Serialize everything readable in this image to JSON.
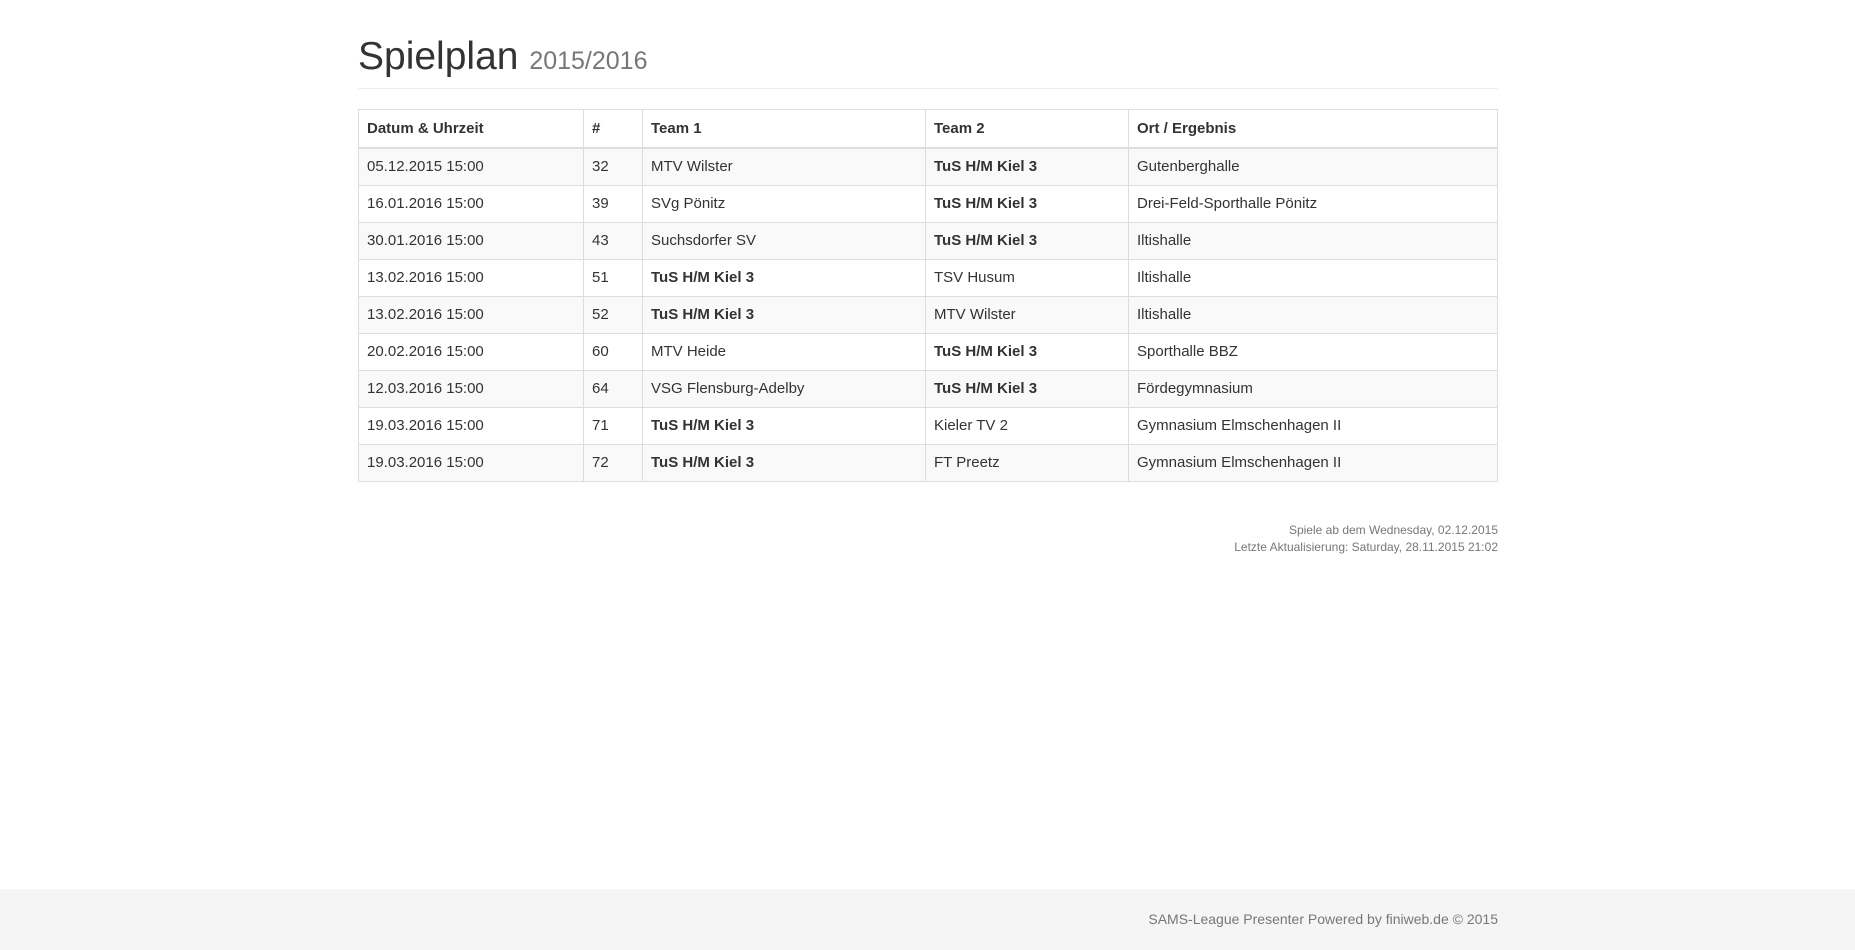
{
  "header": {
    "title": "Spielplan",
    "season": "2015/2016"
  },
  "table": {
    "columns": [
      "Datum & Uhrzeit",
      "#",
      "Team 1",
      "Team 2",
      "Ort / Ergebnis"
    ],
    "rows": [
      {
        "date": "05.12.2015 15:00",
        "num": "32",
        "team1": "MTV Wilster",
        "team2": "TuS H/M Kiel 3",
        "venue": "Gutenberghalle",
        "home_team": 2
      },
      {
        "date": "16.01.2016 15:00",
        "num": "39",
        "team1": "SVg Pönitz",
        "team2": "TuS H/M Kiel 3",
        "venue": "Drei-Feld-Sporthalle Pönitz",
        "home_team": 2
      },
      {
        "date": "30.01.2016 15:00",
        "num": "43",
        "team1": "Suchsdorfer SV",
        "team2": "TuS H/M Kiel 3",
        "venue": "Iltishalle",
        "home_team": 2
      },
      {
        "date": "13.02.2016 15:00",
        "num": "51",
        "team1": "TuS H/M Kiel 3",
        "team2": "TSV Husum",
        "venue": "Iltishalle",
        "home_team": 1
      },
      {
        "date": "13.02.2016 15:00",
        "num": "52",
        "team1": "TuS H/M Kiel 3",
        "team2": "MTV Wilster",
        "venue": "Iltishalle",
        "home_team": 1
      },
      {
        "date": "20.02.2016 15:00",
        "num": "60",
        "team1": "MTV Heide",
        "team2": "TuS H/M Kiel 3",
        "venue": "Sporthalle BBZ",
        "home_team": 2
      },
      {
        "date": "12.03.2016 15:00",
        "num": "64",
        "team1": "VSG Flensburg-Adelby",
        "team2": "TuS H/M Kiel 3",
        "venue": "Fördegymnasium",
        "home_team": 2
      },
      {
        "date": "19.03.2016 15:00",
        "num": "71",
        "team1": "TuS H/M Kiel 3",
        "team2": "Kieler TV 2",
        "venue": "Gymnasium Elmschenhagen II",
        "home_team": 1
      },
      {
        "date": "19.03.2016 15:00",
        "num": "72",
        "team1": "TuS H/M Kiel 3",
        "team2": "FT Preetz",
        "venue": "Gymnasium Elmschenhagen II",
        "home_team": 1
      }
    ]
  },
  "meta": {
    "games_from": "Spiele ab dem Wednesday, 02.12.2015",
    "last_update": "Letzte Aktualisierung: Saturday, 28.11.2015 21:02"
  },
  "footer": {
    "text": "SAMS-League Presenter Powered by finiweb.de © 2015"
  }
}
